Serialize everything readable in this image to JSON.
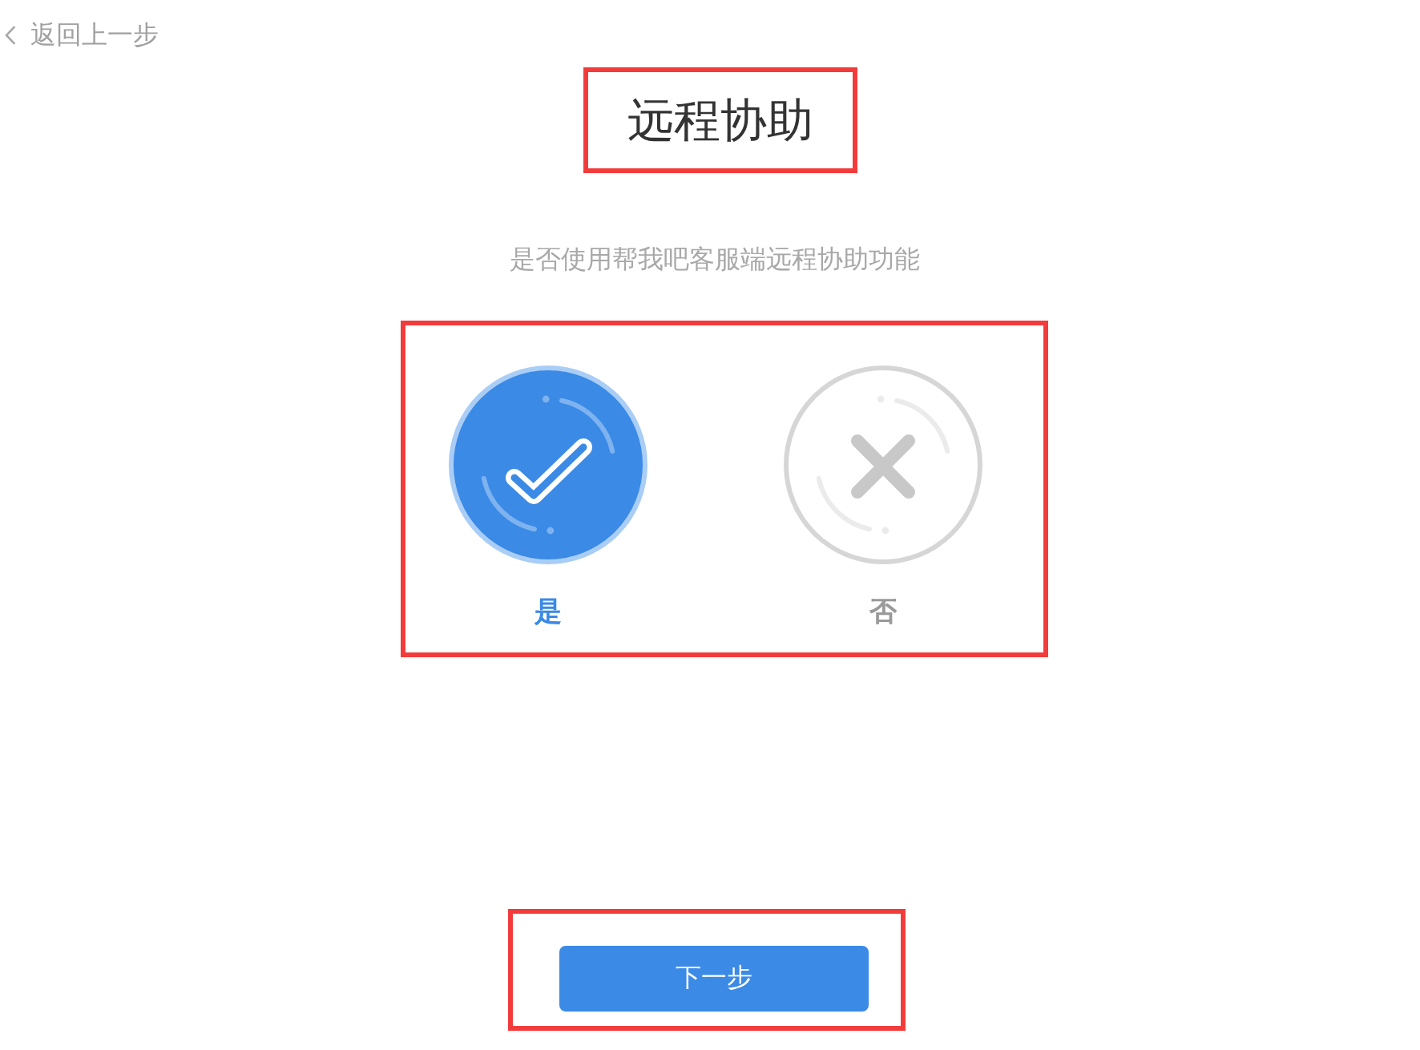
{
  "back_link": {
    "label": "返回上一步"
  },
  "title": {
    "text": "远程协助",
    "highlighted": true
  },
  "prompt": "是否使用帮我吧客服端远程协助功能",
  "choices": {
    "highlighted": true,
    "options": [
      {
        "kind": "yes",
        "label": "是",
        "selected": true
      },
      {
        "kind": "no",
        "label": "否",
        "selected": false
      }
    ]
  },
  "next_button": {
    "label": "下一步",
    "highlighted": true
  }
}
